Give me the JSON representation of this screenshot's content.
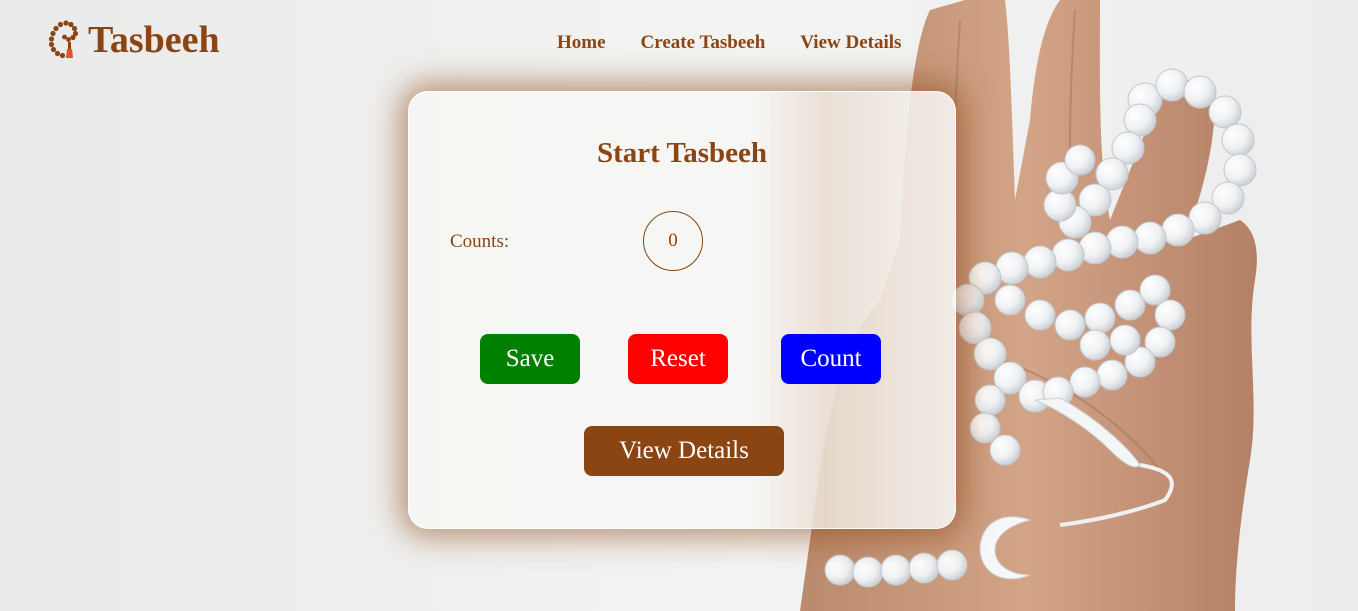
{
  "brand": {
    "name": "Tasbeeh",
    "logo_icon": "prayer-beads-icon",
    "color": "#8b4513"
  },
  "nav": {
    "home": "Home",
    "create": "Create Tasbeeh",
    "view_details": "View Details"
  },
  "card": {
    "title": "Start Tasbeeh",
    "counts_label": "Counts:",
    "count_value": "0",
    "buttons": {
      "save": "Save",
      "reset": "Reset",
      "count": "Count",
      "view_details": "View Details"
    }
  },
  "colors": {
    "accent": "#8b4513",
    "save": "#008000",
    "reset": "#ff0000",
    "count": "#0000ff"
  }
}
